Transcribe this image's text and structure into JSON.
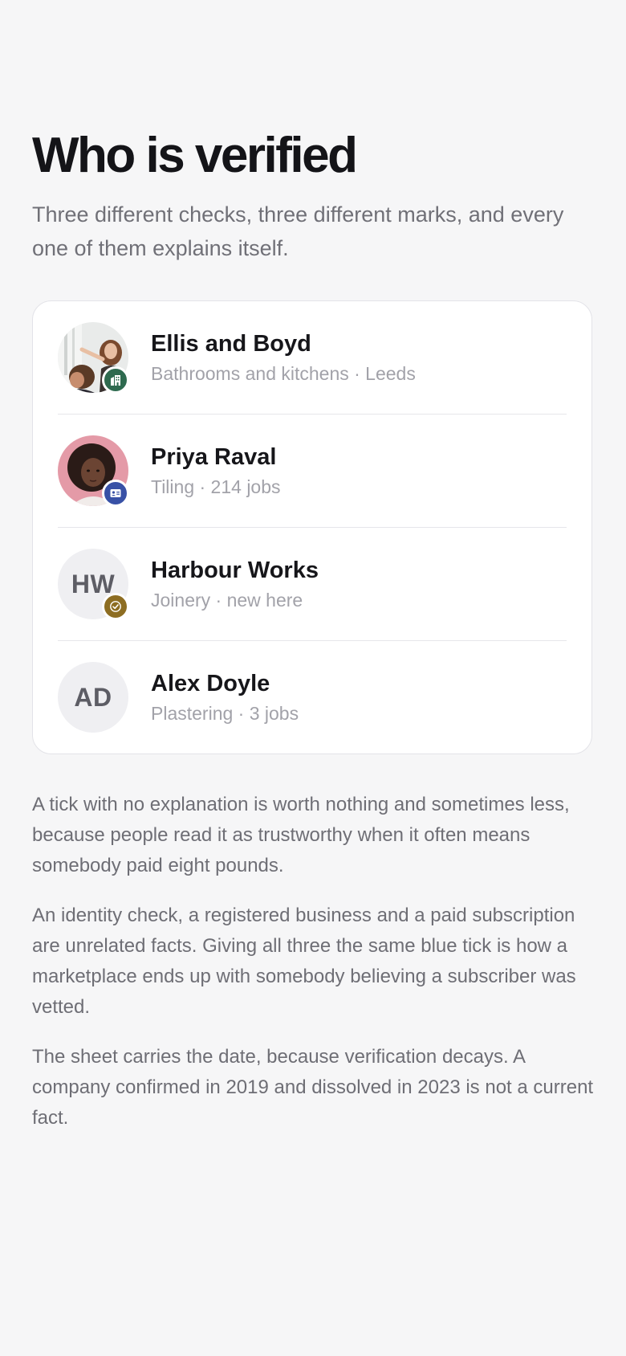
{
  "header": {
    "title": "Who is verified",
    "intro": "Three different checks, three different marks, and every one of them explains itself."
  },
  "providers": [
    {
      "name": "Ellis and Boyd",
      "meta": "Bathrooms and kitchens · Leeds",
      "avatar": "photo",
      "badge": "business-building-icon",
      "badge_color": "#2e6a4f"
    },
    {
      "name": "Priya Raval",
      "meta": "Tiling · 214 jobs",
      "avatar": "photo",
      "badge": "id-card-icon",
      "badge_color": "#3851a6"
    },
    {
      "name": "Harbour Works",
      "meta": "Joinery · new here",
      "initials": "HW",
      "badge": "check-icon",
      "badge_color": "#8d6d22"
    },
    {
      "name": "Alex Doyle",
      "meta": "Plastering · 3 jobs",
      "initials": "AD"
    }
  ],
  "body": {
    "paragraphs": [
      "A tick with no explanation is worth nothing and sometimes less, because people read it as trustworthy when it often means somebody paid eight pounds.",
      "An identity check, a registered business and a paid subscription are unrelated facts. Giving all three the same blue tick is how a marketplace ends up with somebody believing a subscriber was vetted.",
      "The sheet carries the date, because verification decays. A company confirmed in 2019 and dissolved in 2023 is not a current fact."
    ]
  }
}
